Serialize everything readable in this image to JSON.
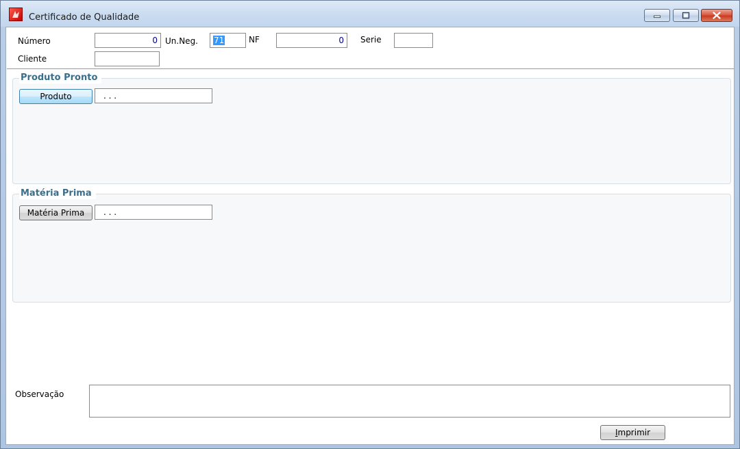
{
  "window": {
    "title": "Certificado de Qualidade",
    "buttons": {
      "minimize": "minimize-icon",
      "maximize": "maximize-icon",
      "close": "close-icon"
    }
  },
  "header": {
    "numero_label": "Número",
    "numero_value": "0",
    "unneg_label": "Un.Neg.",
    "unneg_value": "71",
    "nf_label": "NF",
    "nf_value": "0",
    "serie_label": "Serie",
    "serie_value": "",
    "cliente_label": "Cliente",
    "cliente_value": ""
  },
  "produto_pronto": {
    "title": "Produto Pronto",
    "button_label": "Produto",
    "field_value": ". . ."
  },
  "materia_prima": {
    "title": "Matéria Prima",
    "button_label": "Matéria Prima",
    "field_value": ". . ."
  },
  "observacao": {
    "label": "Observação",
    "value": ""
  },
  "footer": {
    "print_prefix": "",
    "print_mnemonic": "I",
    "print_rest": "mprimir"
  },
  "colors": {
    "group_title": "#3a6f8c",
    "field_text": "#00008b",
    "selection": "#3399ff",
    "close_button": "#c9381e"
  }
}
